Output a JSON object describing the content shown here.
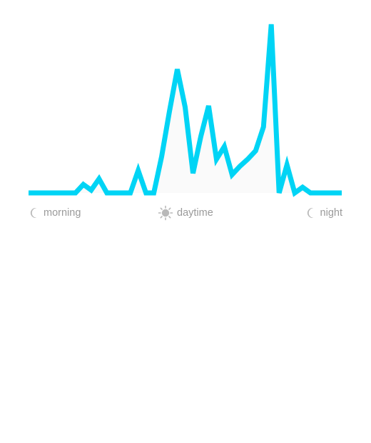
{
  "labels": {
    "morning": "morning",
    "daytime": "daytime",
    "night": "night"
  },
  "icons": {
    "morning": "moon-icon",
    "daytime": "sun-icon",
    "night": "moon-icon"
  },
  "colors": {
    "line": "#00d4f5",
    "fill": "#fafafa",
    "label": "#9a9a9a"
  },
  "chart_data": {
    "type": "area",
    "x_start_label": "morning",
    "x_mid_label": "daytime",
    "x_end_label": "night",
    "values": [
      0,
      0,
      0,
      0,
      0,
      0,
      0,
      6,
      2,
      10,
      0,
      0,
      0,
      0,
      16,
      0,
      0,
      26,
      58,
      88,
      61,
      14,
      40,
      62,
      24,
      33,
      13,
      19,
      24,
      30,
      47,
      120,
      0,
      20,
      0,
      4,
      0,
      0,
      0,
      0,
      0
    ]
  }
}
